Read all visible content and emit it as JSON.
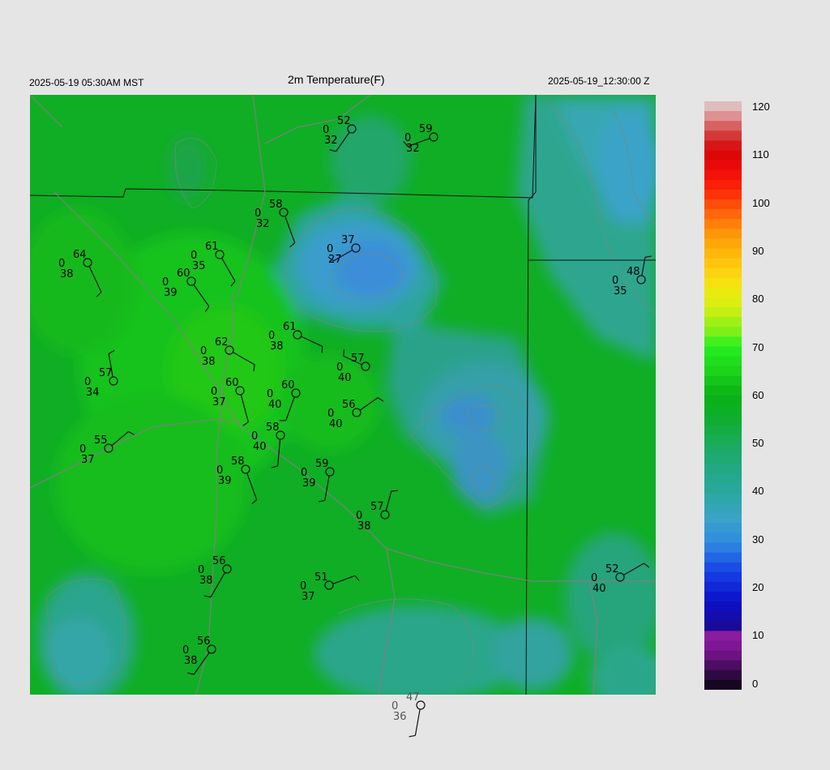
{
  "header": {
    "local_time": "2025-05-19 05:30AM MST",
    "title": "2m Temperature(F)",
    "valid_time": "2025-05-19_12:30:00 Z"
  },
  "colorbar": {
    "labels": [
      "120",
      "110",
      "100",
      "90",
      "80",
      "70",
      "60",
      "50",
      "40",
      "30",
      "20",
      "10",
      "0"
    ],
    "min": 0,
    "max": 120
  },
  "stations": [
    {
      "temp": "52",
      "pres": "0",
      "dew": "32"
    },
    {
      "temp": "59",
      "pres": "0",
      "dew": "32"
    },
    {
      "temp": "58",
      "pres": "0",
      "dew": "32"
    },
    {
      "temp": "37",
      "pres": "0",
      "dew": "27"
    },
    {
      "temp": "64",
      "pres": "0",
      "dew": "38"
    },
    {
      "temp": "61",
      "pres": "0",
      "dew": "35"
    },
    {
      "temp": "60",
      "pres": "0",
      "dew": "39"
    },
    {
      "temp": "48",
      "pres": "0",
      "dew": "35"
    },
    {
      "temp": "61",
      "pres": "0",
      "dew": "38"
    },
    {
      "temp": "62",
      "pres": "0",
      "dew": "38"
    },
    {
      "temp": "57",
      "pres": "0",
      "dew": "40"
    },
    {
      "temp": "57",
      "pres": "0",
      "dew": "34"
    },
    {
      "temp": "60",
      "pres": "0",
      "dew": "37"
    },
    {
      "temp": "60",
      "pres": "0",
      "dew": "40"
    },
    {
      "temp": "56",
      "pres": "0",
      "dew": "40"
    },
    {
      "temp": "55",
      "pres": "0",
      "dew": "37"
    },
    {
      "temp": "58",
      "pres": "0",
      "dew": "40"
    },
    {
      "temp": "58",
      "pres": "0",
      "dew": "39"
    },
    {
      "temp": "59",
      "pres": "0",
      "dew": "39"
    },
    {
      "temp": "57",
      "pres": "0",
      "dew": "38"
    },
    {
      "temp": "56",
      "pres": "0",
      "dew": "38"
    },
    {
      "temp": "51",
      "pres": "0",
      "dew": "37"
    },
    {
      "temp": "52",
      "pres": "0",
      "dew": "40"
    },
    {
      "temp": "56",
      "pres": "0",
      "dew": "38"
    },
    {
      "temp": "47",
      "pres": "0",
      "dew": "36"
    }
  ]
}
